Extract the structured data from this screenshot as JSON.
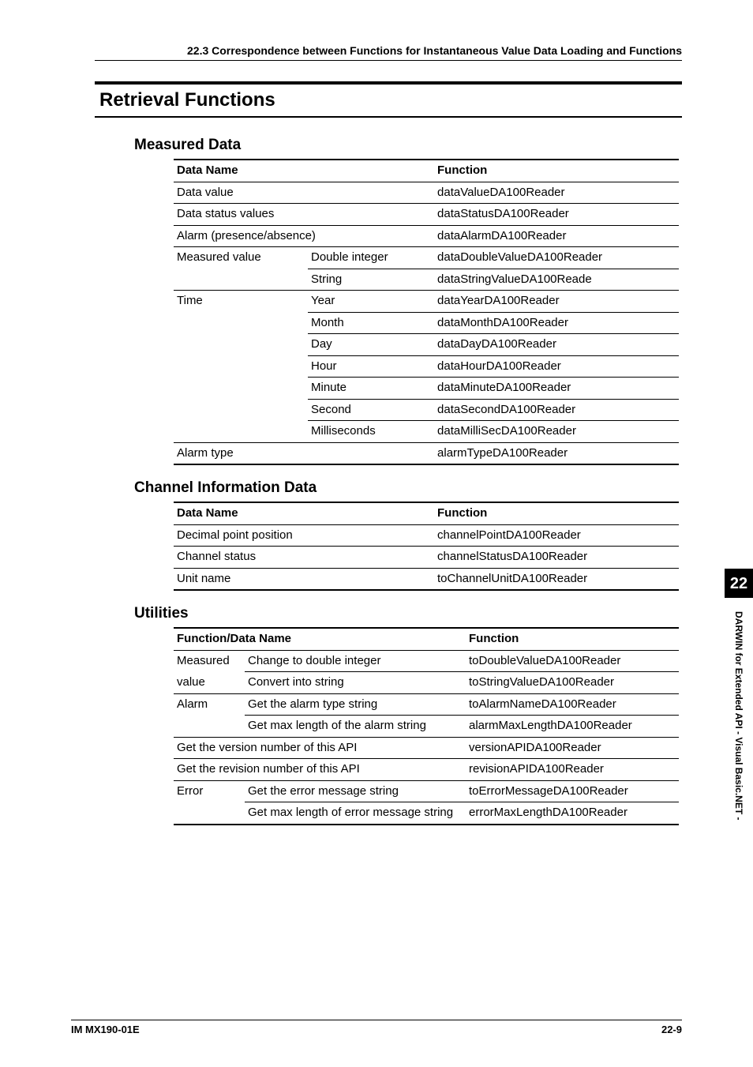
{
  "breadcrumb": "22.3  Correspondence between Functions for Instantaneous Value Data Loading and Functions",
  "h1": "Retrieval Functions",
  "sections": {
    "measured": {
      "title": "Measured Data",
      "head": [
        "Data Name",
        "",
        "Function"
      ],
      "rows": [
        {
          "c1": "Data value",
          "c2": "",
          "c3": "dataValueDA100Reader",
          "span2": true
        },
        {
          "c1": "Data status values",
          "c2": "",
          "c3": "dataStatusDA100Reader",
          "span2": true
        },
        {
          "c1": "Alarm (presence/absence)",
          "c2": "",
          "c3": "dataAlarmDA100Reader",
          "span2": true
        },
        {
          "c1": "Measured value",
          "c2": "Double integer",
          "c3": "dataDoubleValueDA100Reader",
          "c1nb": true
        },
        {
          "c1": "",
          "c2": "String",
          "c3": "dataStringValueDA100Reade"
        },
        {
          "c1": "Time",
          "c2": "Year",
          "c3": "dataYearDA100Reader",
          "c1nb": true
        },
        {
          "c1": "",
          "c2": "Month",
          "c3": "dataMonthDA100Reader",
          "c1nb": true
        },
        {
          "c1": "",
          "c2": "Day",
          "c3": "dataDayDA100Reader",
          "c1nb": true
        },
        {
          "c1": "",
          "c2": "Hour",
          "c3": "dataHourDA100Reader",
          "c1nb": true
        },
        {
          "c1": "",
          "c2": "Minute",
          "c3": "dataMinuteDA100Reader",
          "c1nb": true
        },
        {
          "c1": "",
          "c2": "Second",
          "c3": "dataSecondDA100Reader",
          "c1nb": true
        },
        {
          "c1": "",
          "c2": "Milliseconds",
          "c3": "dataMilliSecDA100Reader"
        },
        {
          "c1": "Alarm type",
          "c2": "",
          "c3": "alarmTypeDA100Reader",
          "span2": true,
          "last": true
        }
      ]
    },
    "channel": {
      "title": "Channel Information Data",
      "head": [
        "Data Name",
        "Function"
      ],
      "rows": [
        {
          "c1": "Decimal point position",
          "c2": "channelPointDA100Reader"
        },
        {
          "c1": "Channel status",
          "c2": "channelStatusDA100Reader"
        },
        {
          "c1": "Unit name",
          "c2": "toChannelUnitDA100Reader",
          "last": true
        }
      ]
    },
    "utilities": {
      "title": "Utilities",
      "head": [
        "Function/Data Name",
        "",
        "Function"
      ],
      "rows": [
        {
          "c1": "Measured",
          "c2": "Change to double integer",
          "c3": "toDoubleValueDA100Reader",
          "c1nb": true
        },
        {
          "c1": "value",
          "c2": "Convert into string",
          "c3": "toStringValueDA100Reader"
        },
        {
          "c1": "Alarm",
          "c2": "Get the alarm type string",
          "c3": "toAlarmNameDA100Reader",
          "c1nb": true
        },
        {
          "c1": "",
          "c2": "Get max length of the alarm string",
          "c3": "alarmMaxLengthDA100Reader"
        },
        {
          "c1": "Get the version number of this API",
          "c2": "",
          "c3": "versionAPIDA100Reader",
          "span2": true
        },
        {
          "c1": "Get the revision number of this API",
          "c2": "",
          "c3": "revisionAPIDA100Reader",
          "span2": true
        },
        {
          "c1": "Error",
          "c2": "Get the error message string",
          "c3": "toErrorMessageDA100Reader",
          "c1nb": true
        },
        {
          "c1": "",
          "c2": "Get max length of  error message string",
          "c3": "errorMaxLengthDA100Reader",
          "last": true
        }
      ]
    }
  },
  "sidetab": {
    "num": "22",
    "label": "DARWIN for Extended API - Visual Basic.NET -"
  },
  "footer": {
    "left": "IM MX190-01E",
    "right": "22-9"
  }
}
